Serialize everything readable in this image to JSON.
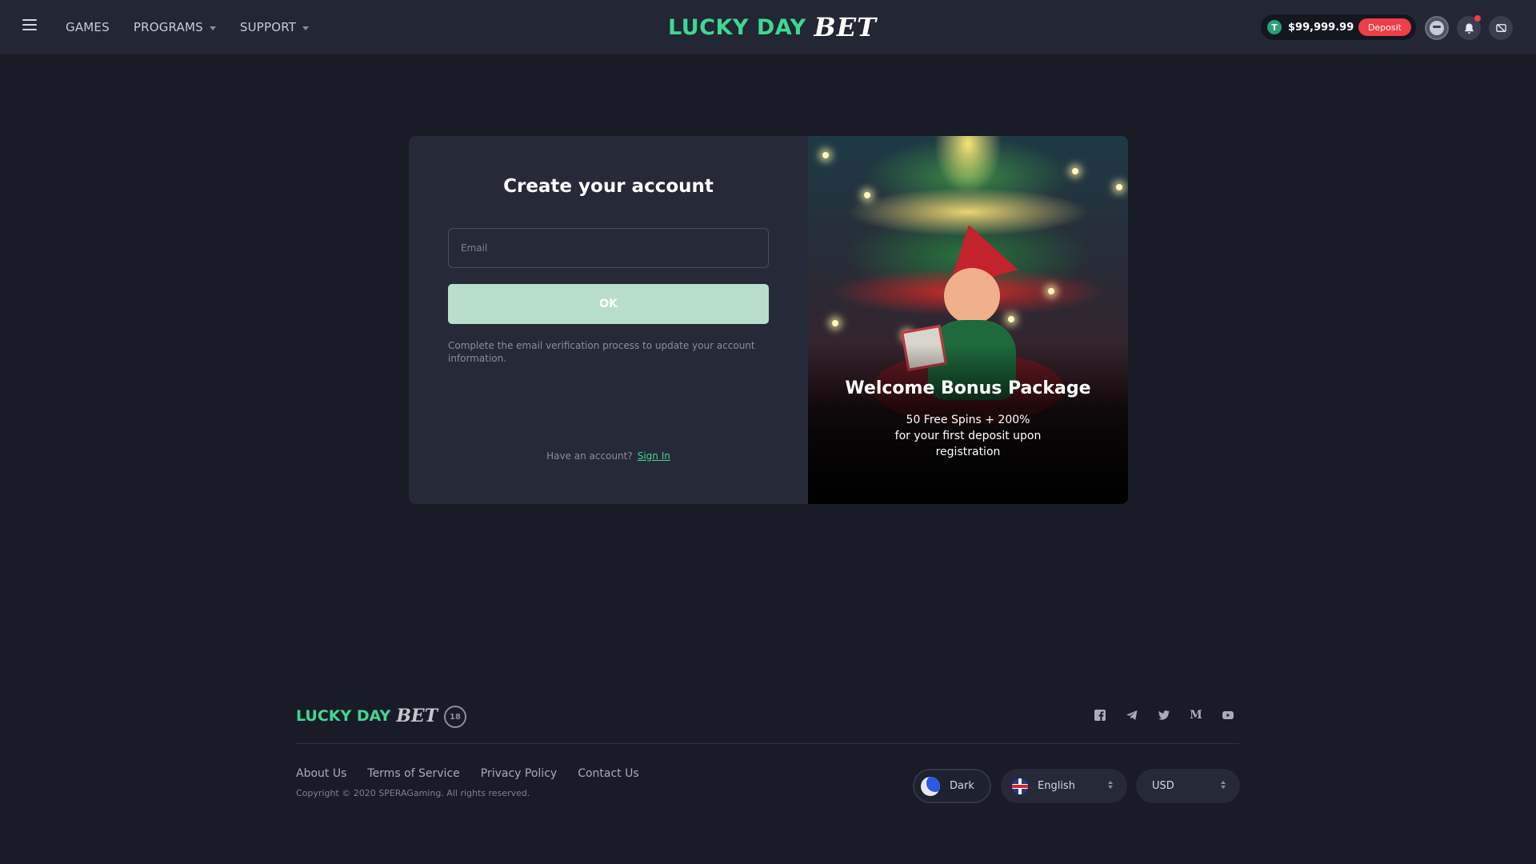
{
  "header": {
    "nav": [
      {
        "label": "GAMES",
        "has_dropdown": false
      },
      {
        "label": "PROGRAMS",
        "has_dropdown": true
      },
      {
        "label": "SUPPORT",
        "has_dropdown": true
      }
    ],
    "brand": {
      "lucky": "LUCKY DAY",
      "bet": "BET"
    },
    "wallet": {
      "currency_icon": "T",
      "balance": "$99,999.99",
      "deposit_label": "Deposit"
    },
    "icons": [
      "menu-icon",
      "avatar-icon",
      "bell-icon",
      "chat-icon"
    ],
    "has_notification": true
  },
  "signup": {
    "title": "Create your account",
    "email_placeholder": "Email",
    "email_value": "",
    "ok_label": "OK",
    "helper_text": "Complete the email verification process to update your account information.",
    "have_account_text": "Have an account?",
    "sign_in_label": "Sign In"
  },
  "promo": {
    "title": "Welcome Bonus Package",
    "line1": "50 Free Spins + 200%",
    "line2": "for your first deposit upon",
    "line3": "registration"
  },
  "footer": {
    "brand": {
      "lucky": "LUCKY DAY",
      "bet": "BET"
    },
    "age_badge": "18",
    "socials": [
      "facebook-icon",
      "telegram-icon",
      "twitter-icon",
      "medium-icon",
      "youtube-icon"
    ],
    "links": [
      "About Us",
      "Terms of Service",
      "Privacy Policy",
      "Contact Us"
    ],
    "copyright": "Copyright © 2020 SPERAGaming. All rights reserved.",
    "theme_label": "Dark",
    "language_label": "English",
    "currency_label": "USD"
  },
  "colors": {
    "background": "#191b27",
    "header": "#232634",
    "panel": "#262938",
    "accent_green": "#3ed891",
    "deposit_red": "#ee3e48",
    "ok_button": "#b7dfc9"
  }
}
